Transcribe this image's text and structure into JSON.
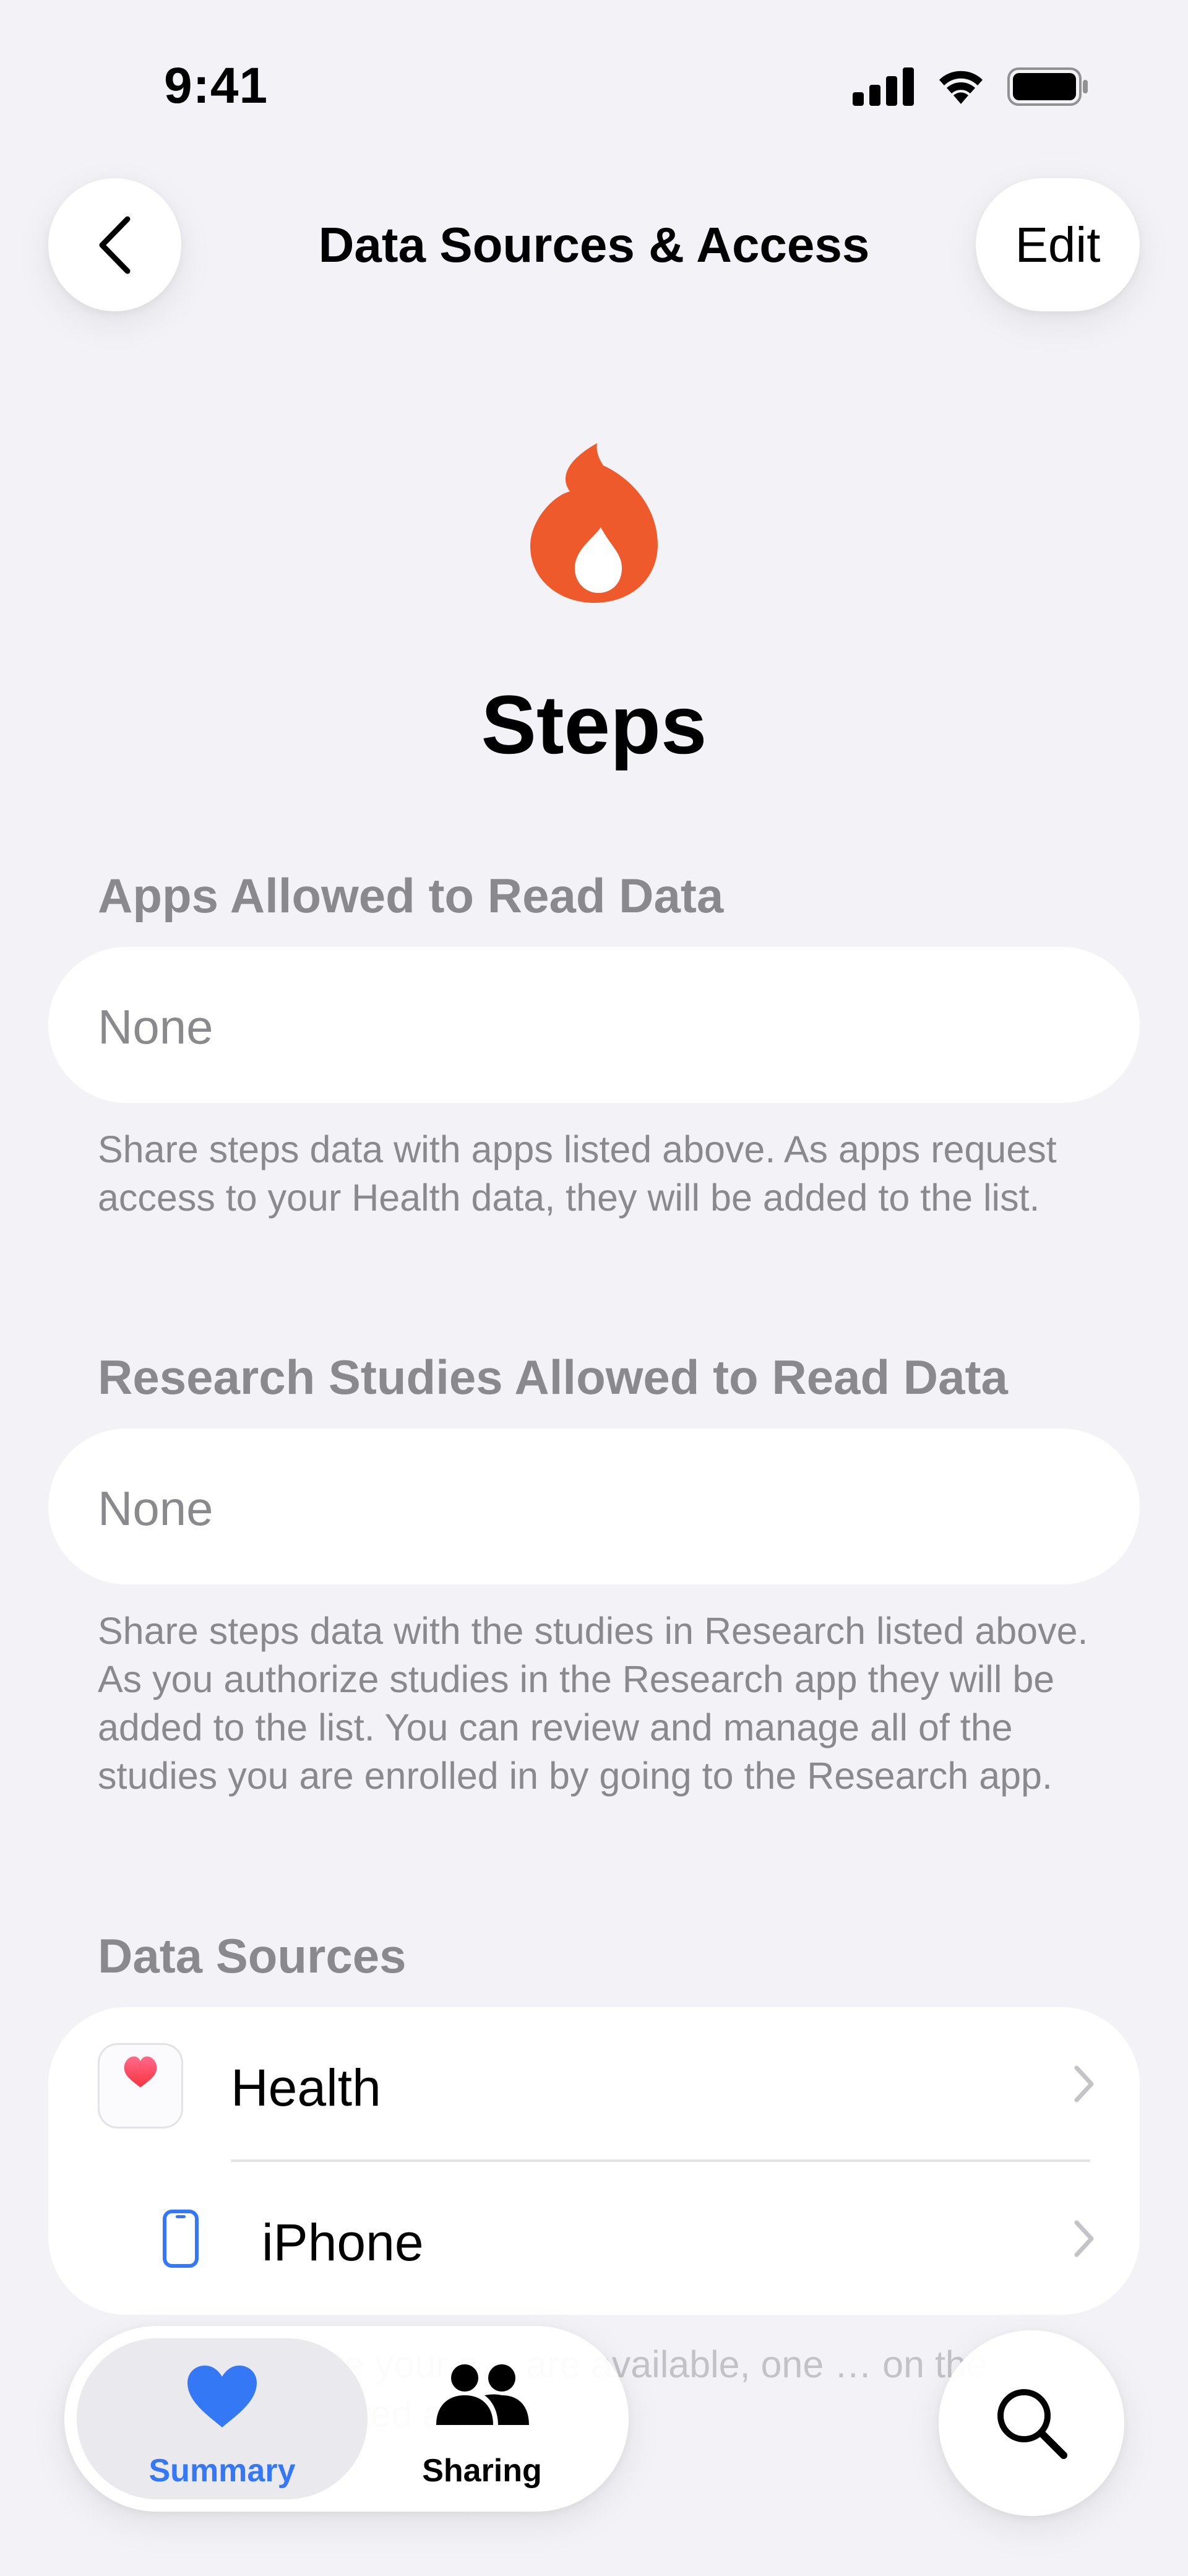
{
  "status_bar": {
    "time": "9:41"
  },
  "nav": {
    "back_label": "Back",
    "title": "Data Sources & Access",
    "edit_label": "Edit"
  },
  "header": {
    "title": "Steps",
    "icon": "flame-icon",
    "icon_color": "#EF5A2C"
  },
  "apps_section": {
    "header": "Apps Allowed to Read Data",
    "value": "None",
    "footer": "Share steps data with apps listed above. As apps request access to your Health data, they will be added to the list."
  },
  "research_section": {
    "header": "Research Studies Allowed to Read Data",
    "value": "None",
    "footer": "Share steps data with the studies in Research listed above. As you authorize studies in the Research app they will be added to the list. You can review and manage all of the studies you are enrolled in by going to the Research app."
  },
  "data_sources": {
    "header": "Data Sources",
    "items": [
      {
        "label": "Health",
        "icon": "health-app-icon"
      },
      {
        "label": "iPhone",
        "icon": "iphone-icon"
      }
    ],
    "footer_partial": "…ved to update your s… are available, one … on the priority ord… listed above."
  },
  "tab_bar": {
    "tabs": [
      {
        "label": "Summary",
        "icon": "heart-icon",
        "selected": true
      },
      {
        "label": "Sharing",
        "icon": "people-icon",
        "selected": false
      }
    ],
    "accent": "#3478F6"
  },
  "search": {
    "icon": "search-icon"
  }
}
